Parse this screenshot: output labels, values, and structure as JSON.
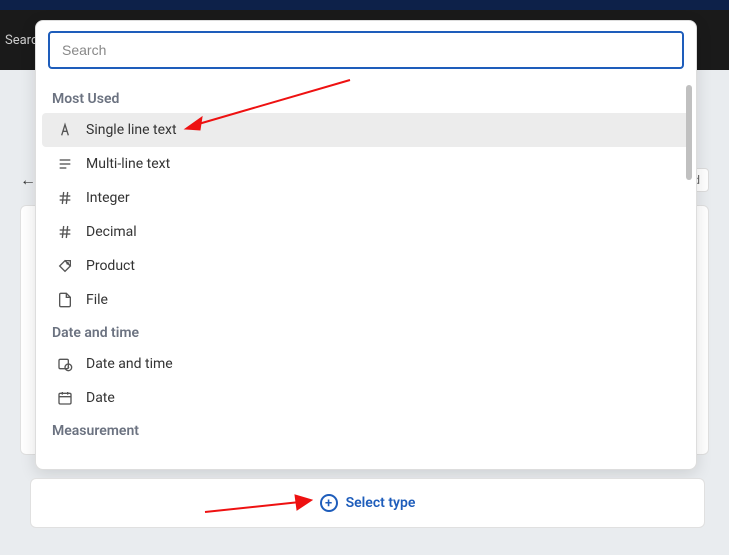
{
  "background": {
    "search_label": "Searc",
    "right_btn_label": "d"
  },
  "dropdown": {
    "search_placeholder": "Search",
    "sections": {
      "most_used": {
        "label": "Most Used",
        "items": {
          "single_line_text": "Single line text",
          "multi_line_text": "Multi-line text",
          "integer": "Integer",
          "decimal": "Decimal",
          "product": "Product",
          "file": "File"
        }
      },
      "date_time": {
        "label": "Date and time",
        "items": {
          "date_and_time": "Date and time",
          "date": "Date"
        }
      },
      "measurement": {
        "label": "Measurement"
      }
    }
  },
  "footer": {
    "select_type": "Select type"
  },
  "colors": {
    "accent": "#1e5dbb",
    "arrow": "#e11"
  }
}
